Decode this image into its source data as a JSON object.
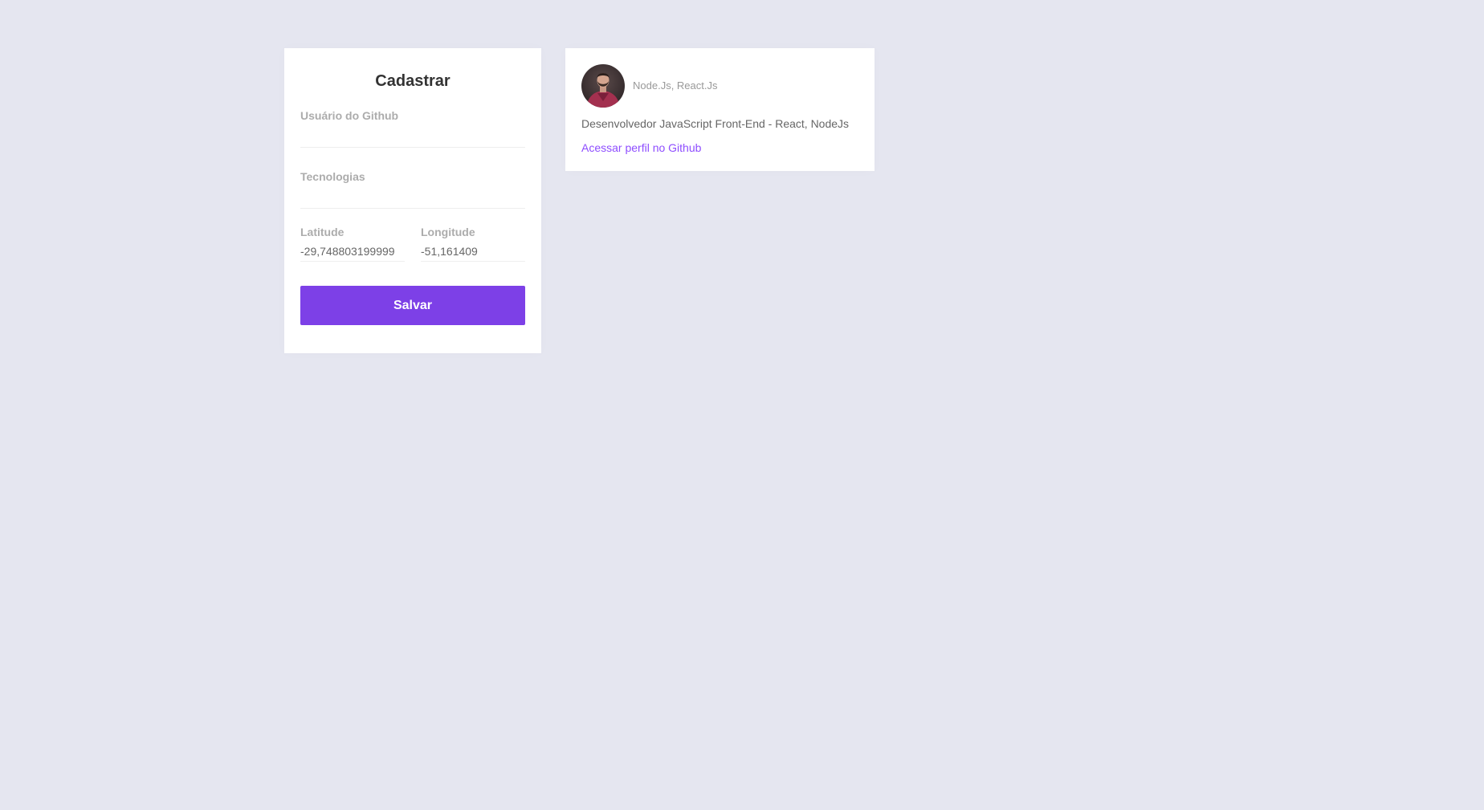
{
  "form": {
    "title": "Cadastrar",
    "github_username": {
      "label": "Usuário do Github",
      "value": ""
    },
    "techs": {
      "label": "Tecnologias",
      "value": ""
    },
    "latitude": {
      "label": "Latitude",
      "value": "-29,748803199999"
    },
    "longitude": {
      "label": "Longitude",
      "value": "-51,161409"
    },
    "save_label": "Salvar"
  },
  "dev": {
    "techs": "Node.Js, React.Js",
    "bio": "Desenvolvedor JavaScript Front-End - React, NodeJs",
    "profile_link": "Acessar perfil no Github"
  },
  "colors": {
    "background": "#e5e6f0",
    "accent": "#7d40e7",
    "link": "#8e4dff"
  }
}
